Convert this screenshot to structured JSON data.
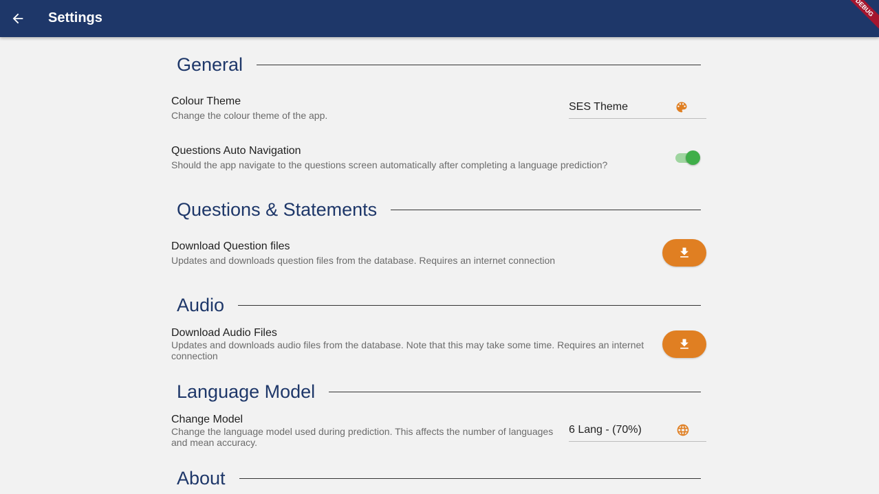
{
  "appbar": {
    "title": "Settings",
    "back_icon": "arrow-left-icon",
    "debug_banner": "DEBUG",
    "color": "#1e3769"
  },
  "sections": {
    "general": {
      "title": "General",
      "colour_theme": {
        "title": "Colour Theme",
        "description": "Change the colour theme of the app.",
        "value": "SES Theme",
        "icon": "palette-icon"
      },
      "auto_navigation": {
        "title": "Questions Auto Navigation",
        "description": "Should the app navigate to the questions screen automatically after completing a language prediction?",
        "enabled": true
      }
    },
    "questions": {
      "title": "Questions & Statements",
      "download": {
        "title": "Download Question files",
        "description": "Updates and downloads question files from the database. Requires an internet connection",
        "icon": "download-icon"
      }
    },
    "audio": {
      "title": "Audio",
      "download": {
        "title": "Download Audio Files",
        "description": "Updates and downloads audio files from the database. Note that this may take some time. Requires an internet connection",
        "icon": "download-icon"
      }
    },
    "language_model": {
      "title": "Language Model",
      "change_model": {
        "title": "Change Model",
        "description": "Change the language model used during prediction. This affects the number of languages and mean accuracy.",
        "value": "6 Lang - (70%)",
        "icon": "globe-icon"
      }
    },
    "about": {
      "title": "About"
    }
  },
  "colors": {
    "accent": "#e07f22",
    "heading": "#1e3769",
    "toggle_on": "#3fae49"
  }
}
